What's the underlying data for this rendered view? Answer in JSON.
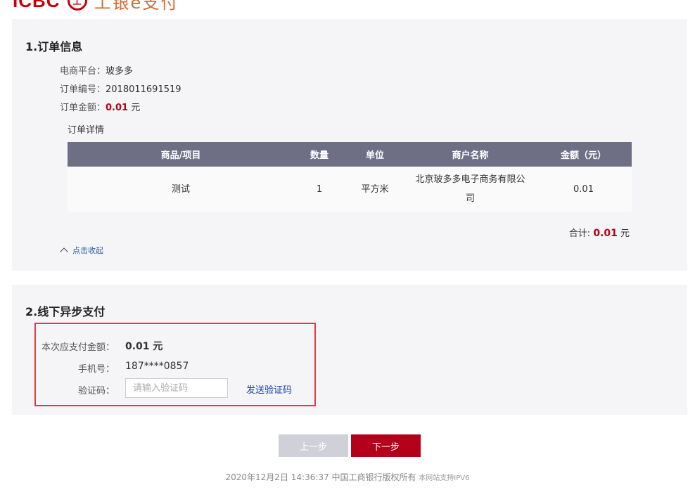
{
  "brand": {
    "logo_text": "ICBC",
    "logo_mark": "工",
    "logo_cn": "工银e支付"
  },
  "order_info": {
    "section_title": "1.订单信息",
    "platform_label": "电商平台：",
    "platform_value": "玻多多",
    "order_no_label": "订单编号：",
    "order_no_value": "2018011691519",
    "amount_label": "订单金额：",
    "amount_value": "0.01",
    "amount_unit": " 元",
    "detail_title": "订单详情",
    "table": {
      "headers": [
        "商品/项目",
        "数量",
        "单位",
        "商户名称",
        "金额（元）"
      ],
      "rows": [
        [
          "测试",
          "1",
          "平方米",
          "北京玻多多电子商务有限公司",
          "0.01"
        ]
      ]
    },
    "total_label": "合计: ",
    "total_value": "0.01",
    "total_unit": " 元",
    "collapse_label": "点击收起"
  },
  "payment": {
    "section_title": "2.线下异步支付",
    "pay_amount_label": "本次应支付金额：",
    "pay_amount_value": "0.01 元",
    "phone_label": "手机号：",
    "phone_value": "187****0857",
    "code_label": "验证码：",
    "code_placeholder": "请输入验证码",
    "send_code_label": "发送验证码"
  },
  "actions": {
    "prev_label": "上一步",
    "next_label": "下一步"
  },
  "footer": {
    "copyright": "2020年12月2日 14:36:37 中国工商银行版权所有",
    "ipv6": "本网站支持IPV6"
  },
  "colors": {
    "accent_red": "#b5001a",
    "header_bg": "#6e6f85",
    "panel_bg": "#f5f5f7",
    "highlight_border": "#e53b3b"
  }
}
